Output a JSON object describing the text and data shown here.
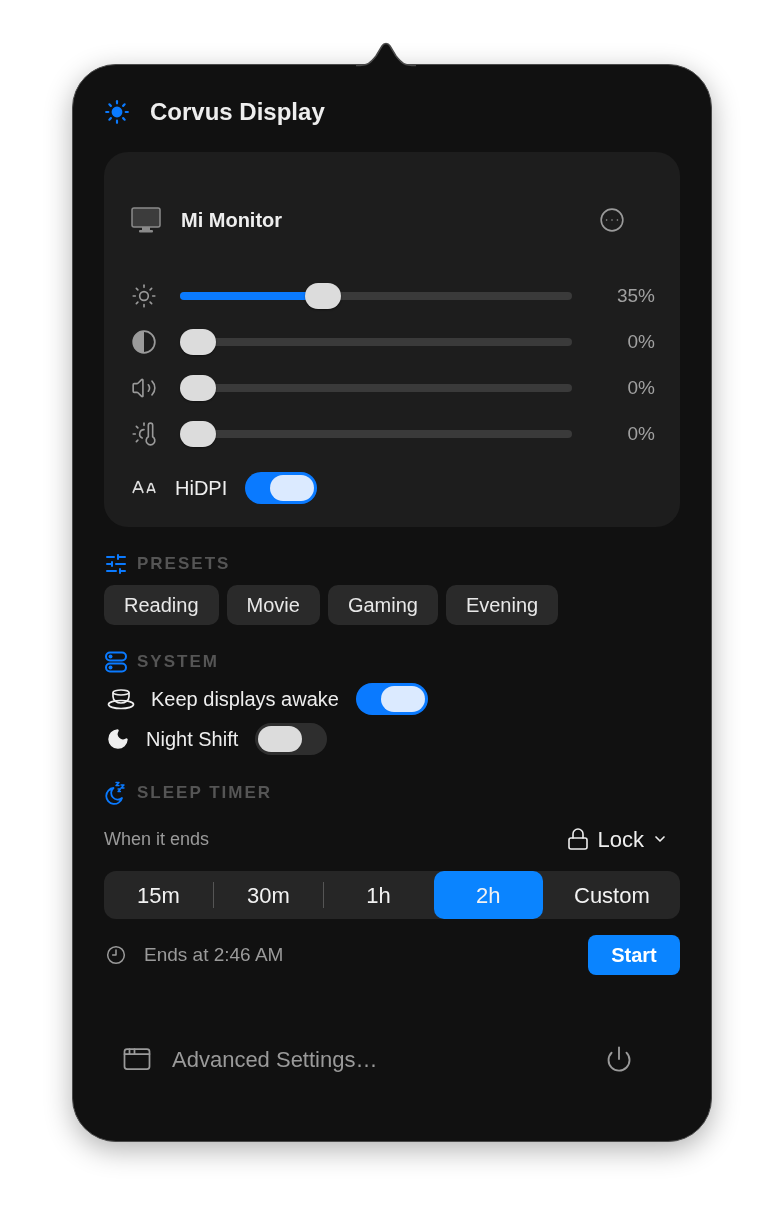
{
  "app": {
    "title": "Corvus Display"
  },
  "display": {
    "name": "Mi Monitor",
    "sliders": [
      {
        "kind": "brightness",
        "level": 0.35,
        "reading": "35%"
      },
      {
        "kind": "contrast",
        "level": 0,
        "reading": "0%"
      },
      {
        "kind": "volume",
        "level": 0,
        "reading": "0%"
      },
      {
        "kind": "temperature",
        "level": 0,
        "reading": "0%"
      }
    ],
    "hidpi": {
      "label": "HiDPI",
      "on": true
    }
  },
  "presets": {
    "title": "PRESETS",
    "items": [
      {
        "label": "Reading"
      },
      {
        "label": "Movie"
      },
      {
        "label": "Gaming"
      },
      {
        "label": "Evening"
      }
    ]
  },
  "system": {
    "title": "SYSTEM",
    "toggles": [
      {
        "kind": "awake",
        "label": "Keep displays awake",
        "on": true
      },
      {
        "kind": "night",
        "label": "Night Shift",
        "on": false
      }
    ]
  },
  "sleep_timer": {
    "title": "SLEEP TIMER",
    "when_label": "When it ends",
    "action": "Lock",
    "durations": [
      {
        "label": "15m",
        "selected": false
      },
      {
        "label": "30m",
        "selected": false
      },
      {
        "label": "1h",
        "selected": false
      },
      {
        "label": "2h",
        "selected": true
      },
      {
        "label": "Custom",
        "selected": false
      }
    ],
    "ends_at": "Ends at 2:46 AM",
    "start_label": "Start"
  },
  "footer": {
    "advanced_label": "Advanced Settings…"
  }
}
